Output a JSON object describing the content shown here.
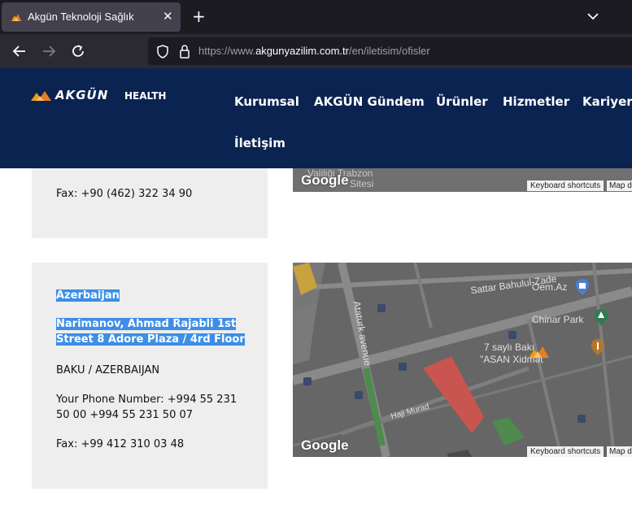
{
  "browser": {
    "tab_title": "Akgün Teknoloji Sağlık",
    "close_glyph": "✕",
    "newtab_glyph": "+",
    "url_prefix": "https://www.",
    "url_host": "akgunyazilim.com.tr",
    "url_path": "/en/iletisim/ofisler"
  },
  "site": {
    "logo_brand": "AKGÜN",
    "logo_health": "HEALTH",
    "menu": [
      "Kurumsal",
      "AKGÜN Gündem",
      "Ürünler",
      "Hizmetler",
      "Kariyer",
      "İletişim"
    ]
  },
  "office_trabzon": {
    "fax": "Fax: +90 (462) 322 34 90",
    "map": {
      "labels": [
        "Valiliği Trabzon",
        "Sitesi"
      ],
      "google": "Google",
      "keyboard": "Keyboard shortcuts",
      "mapdata": "Map d"
    }
  },
  "office_azerbaijan": {
    "country": "Azerbaijan",
    "address_line1": "Narimanov, Ahmad Rajabli 1st",
    "address_line2": "Street 8 Adore Plaza / 4rd Floor",
    "city": "BAKU / AZERBAIJAN",
    "phone_line1": "Your Phone Number: +994 55 231",
    "phone_line2": "50 00 +994 55 231 50 07",
    "fax": "Fax: +99 412 310 03 48",
    "map": {
      "streets": [
        "Sattar Bahulul-Zade",
        "Ataturk avenue",
        "Haji Murad"
      ],
      "places": [
        "Oem.Az",
        "Chinar Park",
        "7 saylı Bakı",
        "\"ASAN Xidmət\""
      ],
      "google": "Google",
      "keyboard": "Keyboard shortcuts",
      "mapdata": "Map d"
    }
  },
  "colors": {
    "header_bg": "#0b2350",
    "logo_accent": "#f39c12",
    "selection": "#3d8ee6",
    "card_bg": "#eeeeee"
  }
}
